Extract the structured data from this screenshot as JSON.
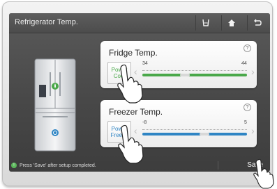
{
  "header": {
    "title": "Refrigerator Temp."
  },
  "toolbar": {
    "icons": [
      "filter-icon",
      "home-icon",
      "back-icon"
    ]
  },
  "fridge_panel": {
    "title": "Fridge Temp.",
    "power_label": "Power Cool",
    "min": "34",
    "max": "44",
    "track_color": "#4aa84a",
    "level": 0.4
  },
  "freezer_panel": {
    "title": "Freezer Temp.",
    "power_label": "Power Freeze",
    "min": "-8",
    "max": "5",
    "track_color": "#2f85c4",
    "level": 0.6
  },
  "status": {
    "message": "Press 'Save' after setup completed.",
    "save_label": "Save"
  },
  "colors": {
    "power_cool": "#4aa84a",
    "power_freeze": "#2f85c4"
  }
}
